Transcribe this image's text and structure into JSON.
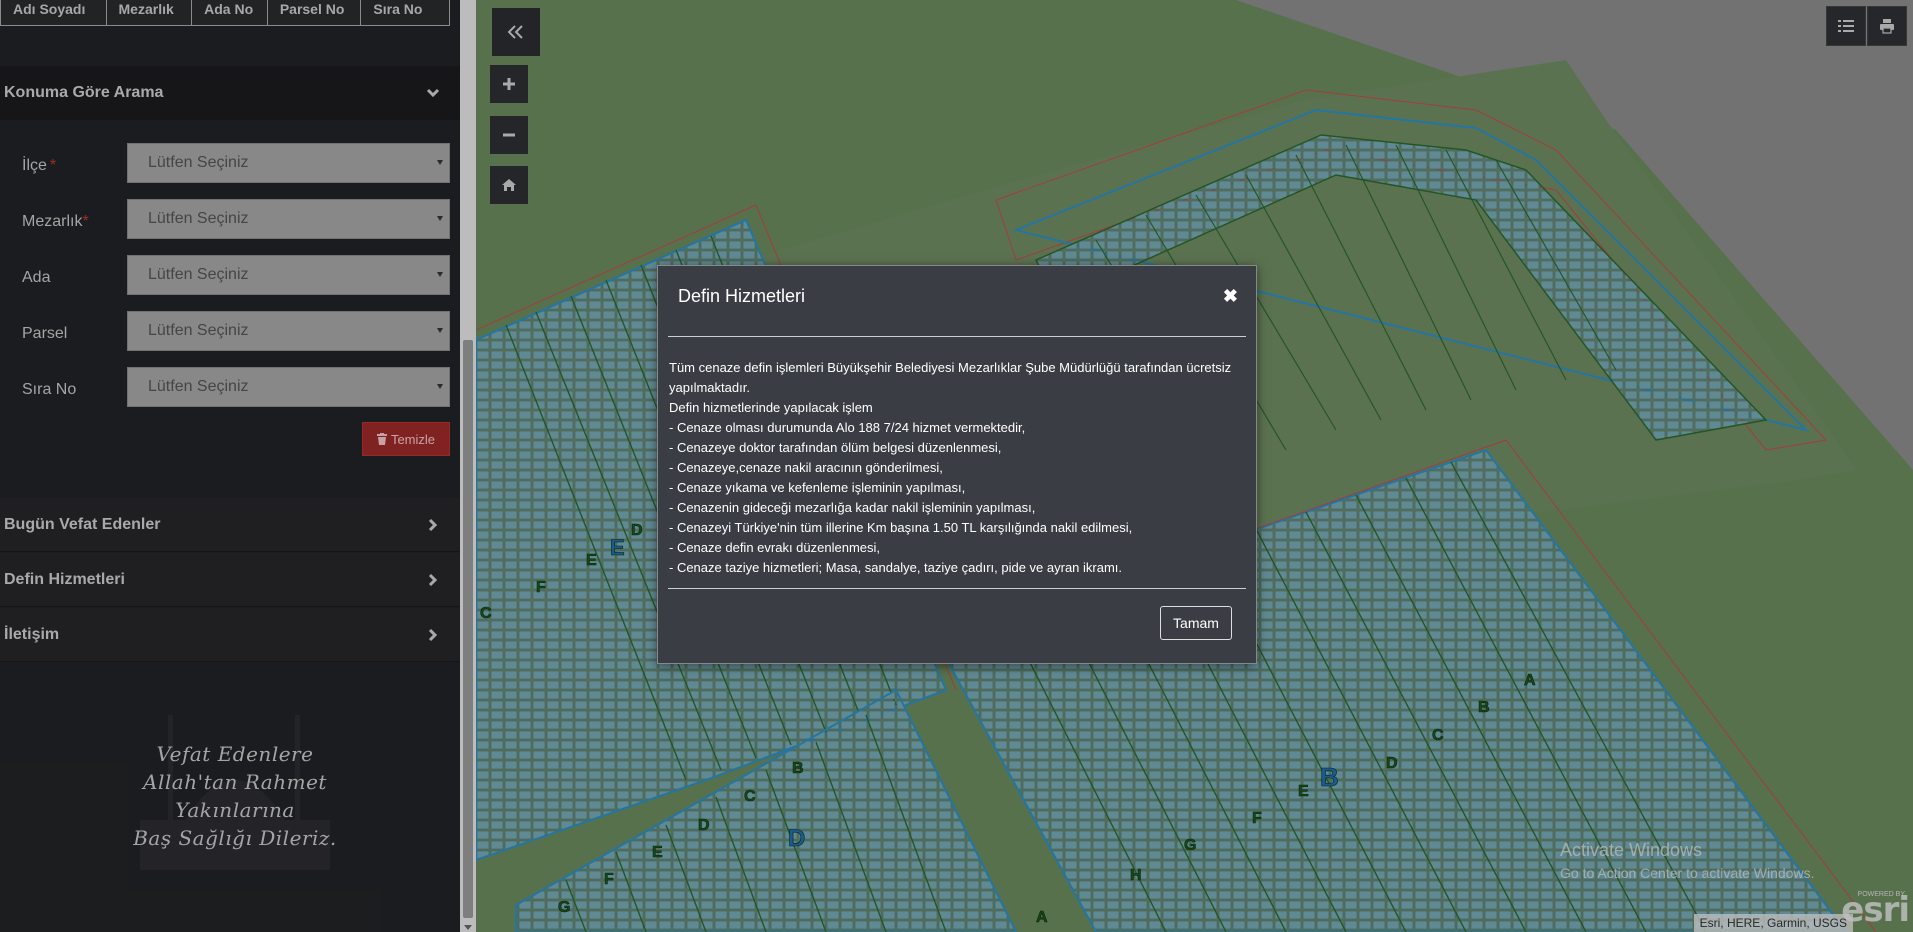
{
  "results_table": {
    "columns": [
      "Adı Soyadı",
      "Mezarlık",
      "Ada No",
      "Parsel No",
      "Sıra No"
    ]
  },
  "location_search": {
    "title": "Konuma Göre Arama",
    "fields": [
      {
        "label": "İlçe",
        "required": true,
        "value": "Lütfen Seçiniz"
      },
      {
        "label": "Mezarlık",
        "required": true,
        "value": "Lütfen Seçiniz"
      },
      {
        "label": "Ada",
        "required": false,
        "value": "Lütfen Seçiniz"
      },
      {
        "label": "Parsel",
        "required": false,
        "value": "Lütfen Seçiniz"
      },
      {
        "label": "Sıra No",
        "required": false,
        "value": "Lütfen Seçiniz"
      }
    ],
    "required_mark": "*",
    "clear_label": "Temizle"
  },
  "sections": {
    "todays_deaths": "Bugün Vefat Edenler",
    "burial_services": "Defin Hizmetleri",
    "contact": "İletişim"
  },
  "memorial": {
    "lines": [
      "Vefat Edenlere",
      "Allah'tan Rahmet",
      "Yakınlarına",
      "Baş Sağlığı Dileriz."
    ]
  },
  "map": {
    "attribution": "Esri, HERE, Garmin, USGS",
    "powered_by": "POWERED BY",
    "logo": "esri",
    "watermark": {
      "title": "Activate Windows",
      "subtitle": "Go to Action Center to activate Windows."
    },
    "block_labels": [
      "A",
      "B",
      "C",
      "D",
      "E",
      "F",
      "G",
      "H"
    ]
  },
  "modal": {
    "title": "Defin Hizmetleri",
    "close_glyph": "✖",
    "ok_label": "Tamam",
    "body": [
      "Tüm cenaze defin işlemleri Büyükşehir Belediyesi Mezarlıklar Şube Müdürlüğü tarafından ücretsiz yapılmaktadır.",
      "Defin hizmetlerinde yapılacak işlem",
      "- Cenaze olması durumunda Alo 188 7/24 hizmet vermektedir,",
      "- Cenazeye doktor tarafından ölüm belgesi düzenlenmesi,",
      "- Cenazeye,cenaze nakil aracının gönderilmesi,",
      "- Cenaze yıkama ve kefenleme işleminin yapılması,",
      "- Cenazenin gideceği mezarlığa kadar nakil işleminin yapılması,",
      "- Cenazeyi Türkiye'nin tüm illerine Km başına 1.50 TL karşılığında nakil edilmesi,",
      "- Cenaze defin evrakı düzenlenmesi,",
      "- Cenaze taziye hizmetleri; Masa, sandalye, taziye çadırı, pide ve ayran ikramı."
    ]
  },
  "colors": {
    "sidebar_bg": "#222326",
    "map_green": "#6b8a5e",
    "map_grey": "#8a8a8a",
    "parcel_blue": "#2b8fc7",
    "grave_cell": "#6fa6b3",
    "danger": "#9e2a2a",
    "modal_bg": "#3a3d43"
  }
}
